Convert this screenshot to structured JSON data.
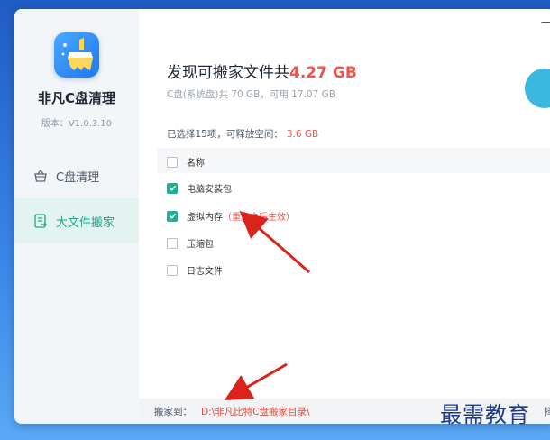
{
  "app": {
    "name": "非凡C盘清理",
    "version": "版本：V1.0.3.10",
    "titlebar_fragment": "一"
  },
  "sidebar": {
    "items": [
      {
        "label": "C盘清理",
        "icon": "basket-icon",
        "active": false
      },
      {
        "label": "大文件搬家",
        "icon": "file-move-icon",
        "active": true
      }
    ]
  },
  "main": {
    "headline_prefix": "发现可搬家文件共",
    "headline_size": "4.27 GB",
    "drive_info": "C盘(系统盘)共 70 GB，可用 17.07 GB",
    "selected_prefix": "已选择15项，可释放空间：",
    "selected_size": "3.6 GB",
    "list": {
      "header": "名称",
      "rows": [
        {
          "label": "电脑安装包",
          "checked": true,
          "note": ""
        },
        {
          "label": "虚拟内存",
          "checked": true,
          "note": "（重启之后生效）"
        },
        {
          "label": "压缩包",
          "checked": false,
          "note": ""
        },
        {
          "label": "日志文件",
          "checked": false,
          "note": ""
        }
      ]
    },
    "bottom": {
      "label": "搬家到：",
      "path": "D:\\非凡比特C盘搬家目录\\",
      "tail": "择"
    }
  },
  "watermark": "最需教育",
  "colors": {
    "accent_green": "#1fae8f",
    "highlight_red": "#f0524a",
    "annotation_arrow": "#d9231c",
    "desktop_blue": "#2a6fd0"
  }
}
